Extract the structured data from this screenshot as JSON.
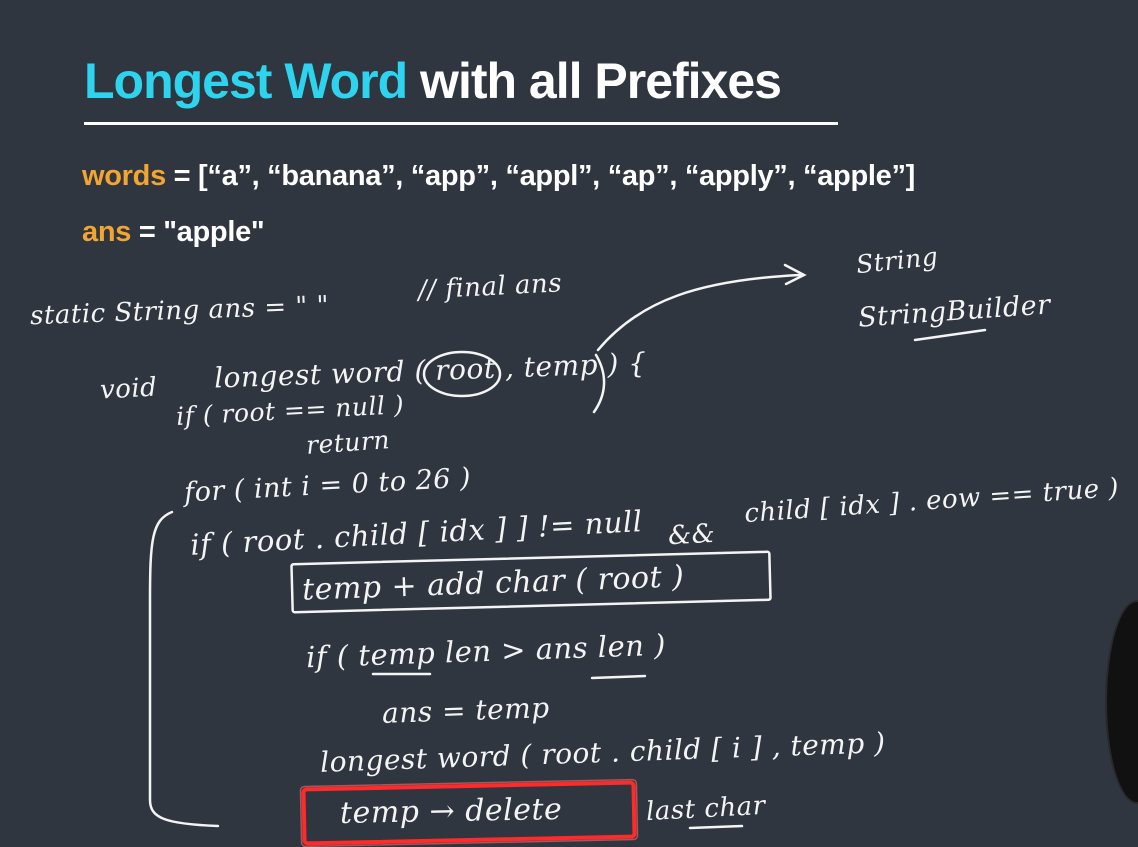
{
  "title": {
    "accent": "Longest Word",
    "rest": " with all Prefixes"
  },
  "words_line": {
    "key": "words",
    "text": " = [“a”, “banana”, “app”, “appl”, “ap”, “apply”, “apple”]"
  },
  "ans_line": {
    "key": "ans",
    "text": " =  \"apple\""
  },
  "handwriting": {
    "string": "String",
    "string_builder": "StringBuilder",
    "static_ans": "static String ans = \"  \"",
    "final_ans_comment": "// final ans",
    "void_kw": "void",
    "signature": "longest word ( root , temp ) {",
    "if_null": "if ( root == null )",
    "return_kw": "return",
    "for_loop": "for ( int i = 0 to 26 )",
    "if_child": "if ( root . child [ idx ] ] != null",
    "and_kw": "&&",
    "eow_check": "child [ idx ] . eow == true )",
    "add_char": "temp + add char ( root )",
    "len_check": "if ( temp len > ans len )",
    "assign": "ans = temp",
    "recurse": "longest word ( root . child [ i ] , temp )",
    "delete": "temp → delete",
    "last_char": "last char"
  },
  "colors": {
    "accent": "#2ed3ee",
    "key": "#f2a531",
    "background": "#2f3640",
    "highlight": "#ff2a2a"
  }
}
